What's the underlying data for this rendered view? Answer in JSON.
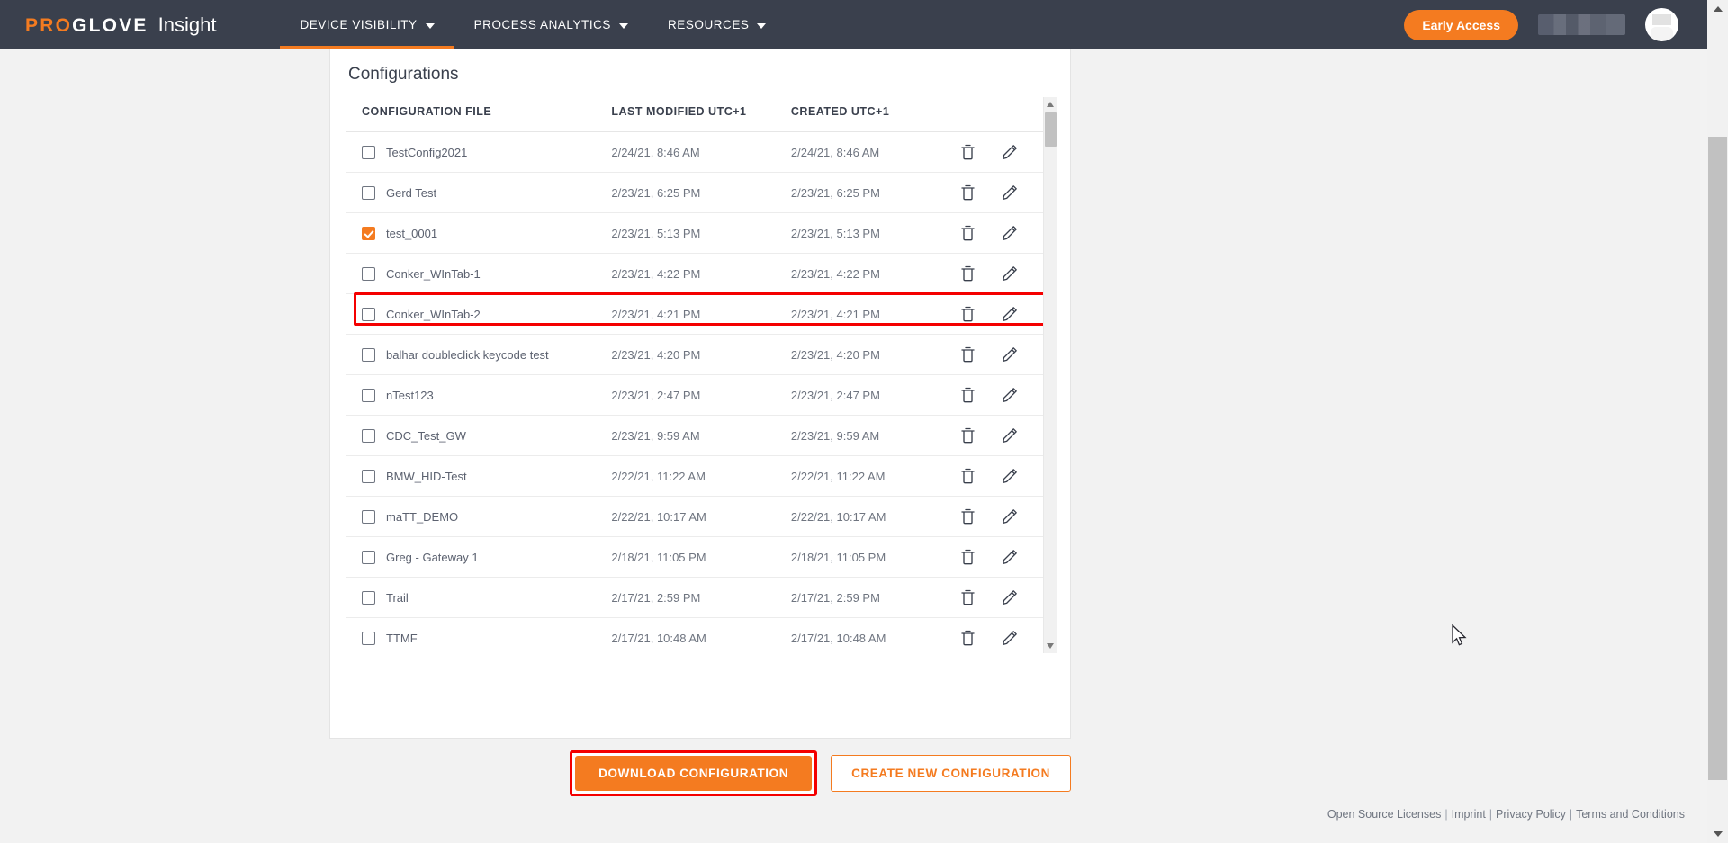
{
  "header": {
    "brand_pro": "PRO",
    "brand_glove": "GLOVE",
    "brand_product": "Insight",
    "nav": [
      {
        "label": "DEVICE VISIBILITY",
        "active": true
      },
      {
        "label": "PROCESS ANALYTICS",
        "active": false
      },
      {
        "label": "RESOURCES",
        "active": false
      }
    ],
    "early_access_label": "Early Access",
    "accent_color": "#f47b20",
    "bar_color": "#3a404d"
  },
  "card": {
    "title": "Configurations",
    "columns": {
      "name": "CONFIGURATION FILE",
      "modified": "LAST MODIFIED UTC+1",
      "created": "CREATED UTC+1"
    },
    "rows": [
      {
        "name": "TestConfig2021",
        "modified": "2/24/21, 8:46 AM",
        "created": "2/24/21, 8:46 AM",
        "checked": false,
        "highlighted": false
      },
      {
        "name": "Gerd Test",
        "modified": "2/23/21, 6:25 PM",
        "created": "2/23/21, 6:25 PM",
        "checked": false,
        "highlighted": false
      },
      {
        "name": "test_0001",
        "modified": "2/23/21, 5:13 PM",
        "created": "2/23/21, 5:13 PM",
        "checked": true,
        "highlighted": true
      },
      {
        "name": "Conker_WInTab-1",
        "modified": "2/23/21, 4:22 PM",
        "created": "2/23/21, 4:22 PM",
        "checked": false,
        "highlighted": false
      },
      {
        "name": "Conker_WInTab-2",
        "modified": "2/23/21, 4:21 PM",
        "created": "2/23/21, 4:21 PM",
        "checked": false,
        "highlighted": false
      },
      {
        "name": "balhar doubleclick keycode test",
        "modified": "2/23/21, 4:20 PM",
        "created": "2/23/21, 4:20 PM",
        "checked": false,
        "highlighted": false
      },
      {
        "name": "nTest123",
        "modified": "2/23/21, 2:47 PM",
        "created": "2/23/21, 2:47 PM",
        "checked": false,
        "highlighted": false
      },
      {
        "name": "CDC_Test_GW",
        "modified": "2/23/21, 9:59 AM",
        "created": "2/23/21, 9:59 AM",
        "checked": false,
        "highlighted": false
      },
      {
        "name": "BMW_HID-Test",
        "modified": "2/22/21, 11:22 AM",
        "created": "2/22/21, 11:22 AM",
        "checked": false,
        "highlighted": false
      },
      {
        "name": "maTT_DEMO",
        "modified": "2/22/21, 10:17 AM",
        "created": "2/22/21, 10:17 AM",
        "checked": false,
        "highlighted": false
      },
      {
        "name": "Greg - Gateway 1",
        "modified": "2/18/21, 11:05 PM",
        "created": "2/18/21, 11:05 PM",
        "checked": false,
        "highlighted": false
      },
      {
        "name": "Trail",
        "modified": "2/17/21, 2:59 PM",
        "created": "2/17/21, 2:59 PM",
        "checked": false,
        "highlighted": false
      },
      {
        "name": "TTMF",
        "modified": "2/17/21, 10:48 AM",
        "created": "2/17/21, 10:48 AM",
        "checked": false,
        "highlighted": false
      }
    ],
    "row_icons": {
      "delete": "trash-icon",
      "edit": "pencil-icon"
    }
  },
  "buttons": {
    "download": "DOWNLOAD CONFIGURATION",
    "create": "CREATE NEW CONFIGURATION"
  },
  "footer": {
    "links": [
      "Open Source Licenses",
      "Imprint",
      "Privacy Policy",
      "Terms and Conditions"
    ],
    "separator": "|"
  },
  "annotations": {
    "highlight_color": "#f40000"
  }
}
